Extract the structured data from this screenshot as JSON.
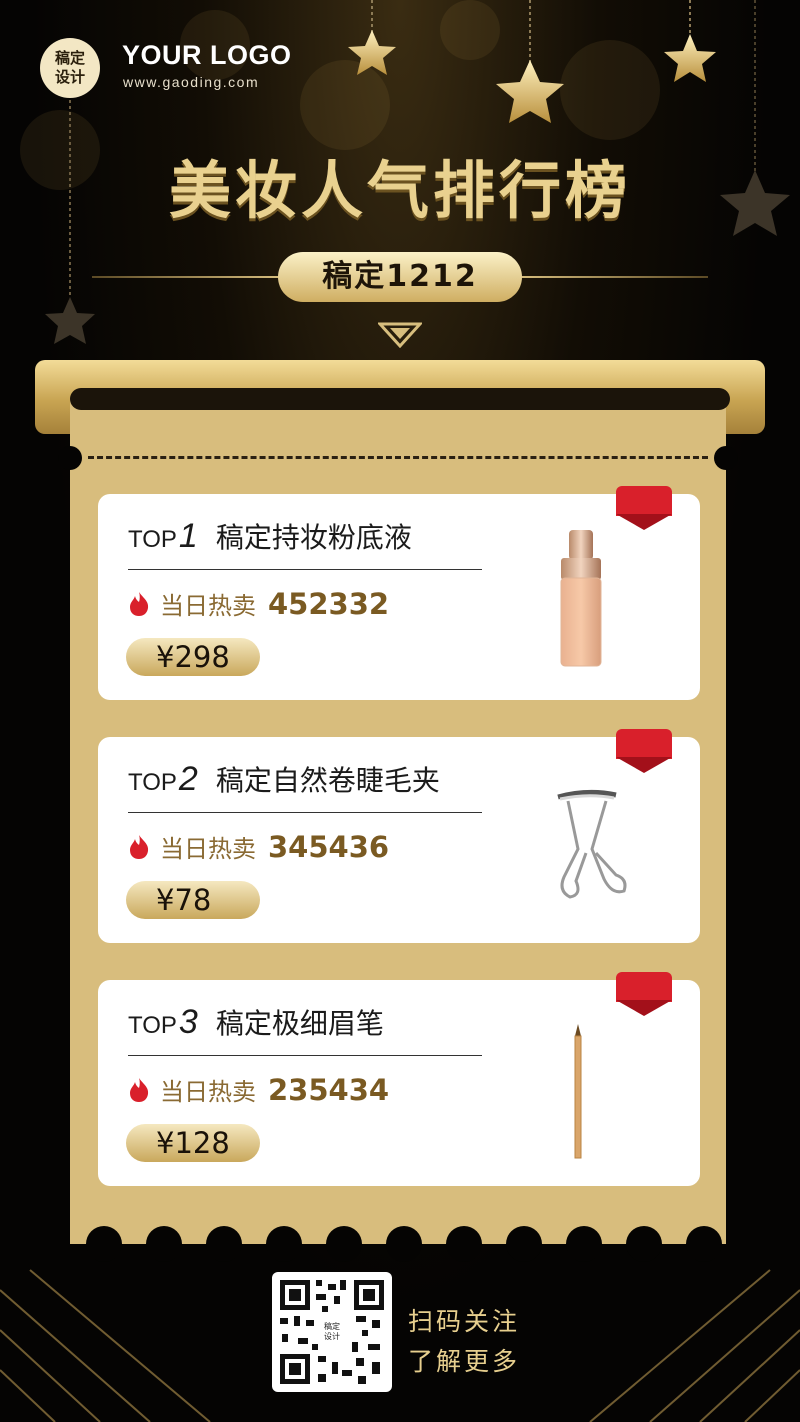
{
  "header": {
    "logo_badge_line1": "稿定",
    "logo_badge_line2": "设计",
    "logo_text": "YOUR LOGO",
    "logo_url": "www.gaoding.com",
    "title": "美妆人气排行榜",
    "subtitle": "稿定1212"
  },
  "items": [
    {
      "top_label": "TOP",
      "rank": "1",
      "name": "稿定持妆粉底液",
      "sales_label": "当日热卖",
      "sales_value": "452332",
      "price": "¥298",
      "icon": "foundation-bottle-icon"
    },
    {
      "top_label": "TOP",
      "rank": "2",
      "name": "稿定自然卷睫毛夹",
      "sales_label": "当日热卖",
      "sales_value": "345436",
      "price": "¥78",
      "icon": "eyelash-curler-icon"
    },
    {
      "top_label": "TOP",
      "rank": "3",
      "name": "稿定极细眉笔",
      "sales_label": "当日热卖",
      "sales_value": "235434",
      "price": "¥128",
      "icon": "eyebrow-pencil-icon"
    }
  ],
  "footer": {
    "qr_badge_line1": "稿定",
    "qr_badge_line2": "设计",
    "qr_text_line1": "扫码关注",
    "qr_text_line2": "了解更多"
  },
  "colors": {
    "gold": "#d8bd7d",
    "ribbon": "#d9202b",
    "background": "#050403"
  }
}
